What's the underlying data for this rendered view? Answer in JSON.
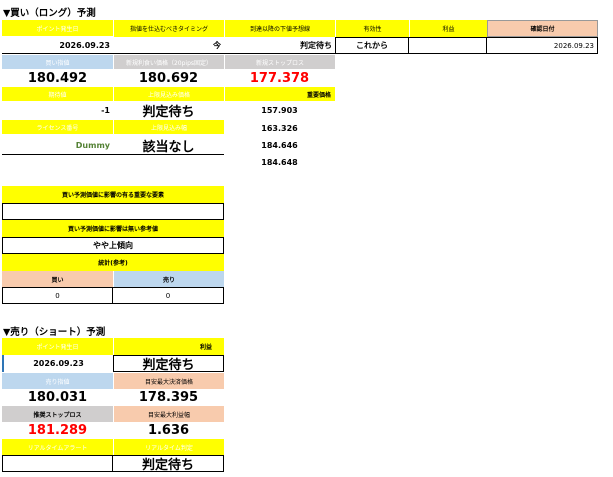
{
  "buy": {
    "title": "▼買い（ロング）予測",
    "h_point_date": "ポイント発生日",
    "h_entry_timing": "指値を仕込むべきタイミング",
    "h_after_reach": "到達以降の下値予想線",
    "h_validity": "有効性",
    "h_profit": "利益",
    "h_judge_date": "確認日付",
    "point_date": "2026.09.23",
    "entry_timing": "今",
    "after_reach": "判定待ち",
    "validity": "これから",
    "profit": "",
    "judge_date": "2026.09.23",
    "h_buy_limit": "買い指値",
    "h_new_sell_limit": "新規利食い価格（20pips固定）",
    "h_new_stoploss": "新規ストップロス",
    "buy_limit": "180.492",
    "new_sell_limit": "180.692",
    "new_stoploss": "177.378",
    "h_expected": "期待値",
    "h_upper_target": "上限見込み価格",
    "h_key_price": "重要価格",
    "expected": "-1",
    "upper_target": "判定待ち",
    "key_prices": [
      "157.903",
      "163.326",
      "184.646",
      "184.648"
    ],
    "h_license": "ライセンス番号",
    "h_upper_amount": "上限見込み幅",
    "license": "Dummy",
    "upper_amount": "該当なし",
    "h_factors": "買い予測価値に影響の有る重要な要素",
    "factors": "",
    "h_trend": "買い予測価値に影響は無い参考値",
    "trend": "やや上傾向",
    "h_stats": "統計(参考)",
    "h_stat_buy": "買い",
    "h_stat_sell": "売り",
    "stat_buy": "0",
    "stat_sell": "0"
  },
  "sell": {
    "title": "▼売り（ショート）予測",
    "h_point_date": "ポイント発生日",
    "h_profit": "利益",
    "point_date": "2026.09.23",
    "profit": "判定待ち",
    "h_sell_limit": "売り指値",
    "h_target_tp": "目安最大決済価格",
    "sell_limit": "180.031",
    "target_tp": "178.395",
    "h_stoploss": "推奨ストップロス",
    "h_max_profit": "目安最大利益幅",
    "stoploss": "181.289",
    "max_profit": "1.636",
    "h_realtime_alert": "リアルタイムアラート",
    "h_realtime_judge": "リアルタイム判定",
    "realtime_alert": "",
    "realtime_judge": "判定待ち"
  },
  "colors": {
    "yellow": "#ffff00",
    "blue": "#bdd7ee",
    "peach": "#f8cbad",
    "gray": "#d0cece",
    "red": "#ff0000",
    "green": "#548235"
  }
}
